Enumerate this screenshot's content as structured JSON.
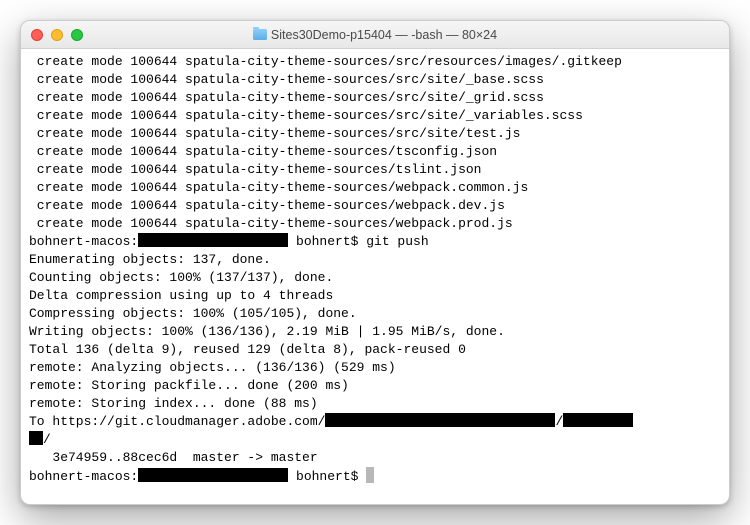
{
  "window": {
    "title": "Sites30Demo-p15404 — -bash — 80×24"
  },
  "redactWidths": {
    "promptDir": 150,
    "urlMid": 230,
    "urlEnd": 70,
    "tail": 14
  },
  "lines": [
    {
      "t": "create",
      "path": "spatula-city-theme-sources/src/resources/images/.gitkeep"
    },
    {
      "t": "create",
      "path": "spatula-city-theme-sources/src/site/_base.scss"
    },
    {
      "t": "create",
      "path": "spatula-city-theme-sources/src/site/_grid.scss"
    },
    {
      "t": "create",
      "path": "spatula-city-theme-sources/src/site/_variables.scss"
    },
    {
      "t": "create",
      "path": "spatula-city-theme-sources/src/site/test.js"
    },
    {
      "t": "create",
      "path": "spatula-city-theme-sources/tsconfig.json"
    },
    {
      "t": "create",
      "path": "spatula-city-theme-sources/tslint.json"
    },
    {
      "t": "create",
      "path": "spatula-city-theme-sources/webpack.common.js"
    },
    {
      "t": "create",
      "path": "spatula-city-theme-sources/webpack.dev.js"
    },
    {
      "t": "create",
      "path": "spatula-city-theme-sources/webpack.prod.js"
    },
    {
      "t": "prompt",
      "host": "bohnert-macos:",
      "user": " bohnert$ ",
      "cmd": "git push"
    },
    {
      "t": "plain",
      "text": "Enumerating objects: 137, done."
    },
    {
      "t": "plain",
      "text": "Counting objects: 100% (137/137), done."
    },
    {
      "t": "plain",
      "text": "Delta compression using up to 4 threads"
    },
    {
      "t": "plain",
      "text": "Compressing objects: 100% (105/105), done."
    },
    {
      "t": "plain",
      "text": "Writing objects: 100% (136/136), 2.19 MiB | 1.95 MiB/s, done."
    },
    {
      "t": "plain",
      "text": "Total 136 (delta 9), reused 129 (delta 8), pack-reused 0"
    },
    {
      "t": "plain",
      "text": "remote: Analyzing objects... (136/136) (529 ms)"
    },
    {
      "t": "plain",
      "text": "remote: Storing packfile... done (200 ms)"
    },
    {
      "t": "plain",
      "text": "remote: Storing index... done (88 ms)"
    },
    {
      "t": "url",
      "prefix": "To https://git.cloudmanager.adobe.com/",
      "sep": "/"
    },
    {
      "t": "urlcont",
      "suffix": "/"
    },
    {
      "t": "plain",
      "text": "   3e74959..88cec6d  master -> master"
    },
    {
      "t": "prompt",
      "host": "bohnert-macos:",
      "user": " bohnert$ ",
      "cmd": "",
      "cursor": true
    }
  ],
  "createPrefix": " create mode 100644 "
}
